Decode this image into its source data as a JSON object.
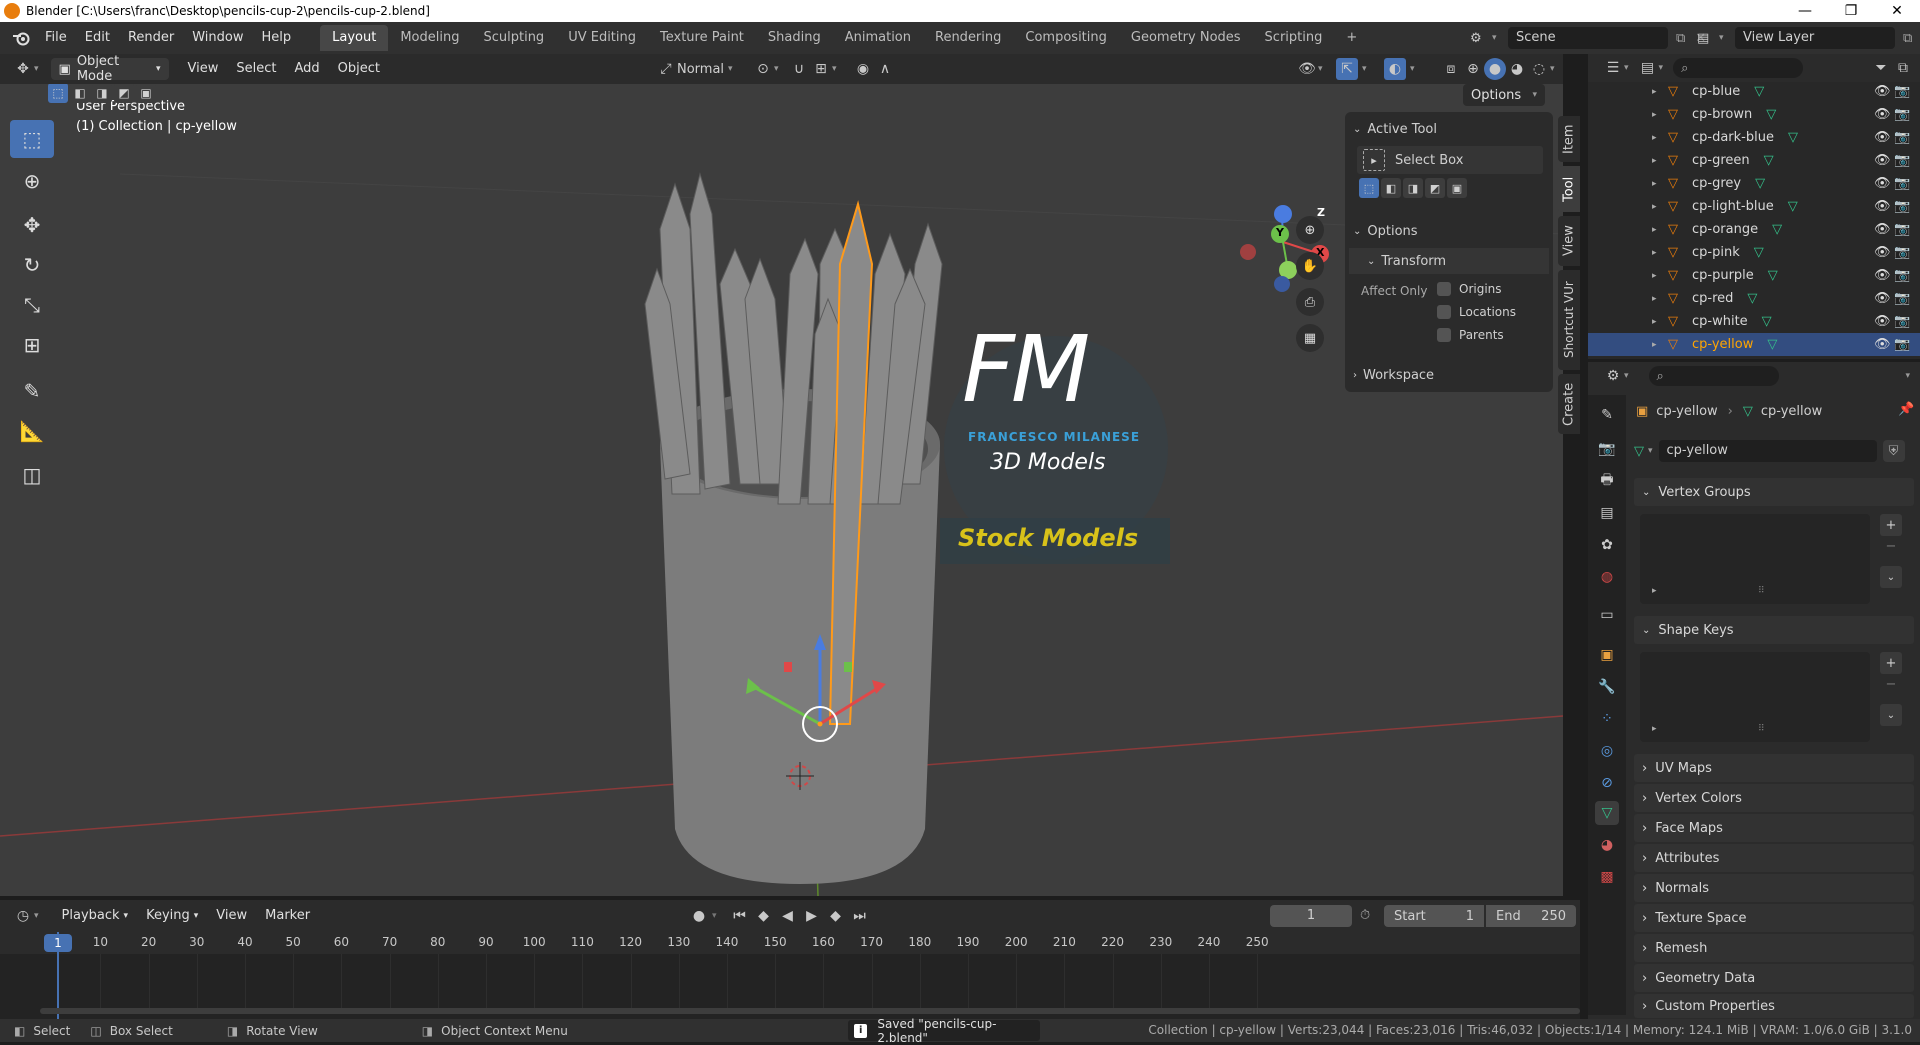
{
  "title": "Blender [C:\\Users\\franc\\Desktop\\pencils-cup-2\\pencils-cup-2.blend]",
  "window_controls": [
    "—",
    "❐",
    "✕"
  ],
  "menu": [
    "File",
    "Edit",
    "Render",
    "Window",
    "Help"
  ],
  "workspaces": [
    "Layout",
    "Modeling",
    "Sculpting",
    "UV Editing",
    "Texture Paint",
    "Shading",
    "Animation",
    "Rendering",
    "Compositing",
    "Geometry Nodes",
    "Scripting"
  ],
  "add_workspace": "+",
  "scene": "Scene",
  "view_layer": "View Layer",
  "viewport_header": {
    "mode": "Object Mode",
    "menus": [
      "View",
      "Select",
      "Add",
      "Object"
    ],
    "orientation": "Normal",
    "options": "Options"
  },
  "viewport": {
    "perspective": "User Perspective",
    "collection": "(1) Collection | cp-yellow",
    "watermark_initials": "FM",
    "watermark_name": "FRANCESCO MILANESE",
    "watermark_sub": "3D Models",
    "watermark_stock": "Stock Models",
    "gizmo_labels": {
      "x": "X",
      "y": "Y",
      "z": "Z"
    }
  },
  "npanel": {
    "active_tool": "Active Tool",
    "tool_name": "Select Box",
    "options": "Options",
    "transform": "Transform",
    "affect_only": "Affect Only",
    "origins": "Origins",
    "locations": "Locations",
    "parents": "Parents",
    "workspace": "Workspace",
    "tabs": [
      "Item",
      "Tool",
      "View",
      "Shortcut VUr",
      "Create"
    ]
  },
  "outliner": {
    "items": [
      {
        "name": "cp-blue"
      },
      {
        "name": "cp-brown"
      },
      {
        "name": "cp-dark-blue"
      },
      {
        "name": "cp-green"
      },
      {
        "name": "cp-grey"
      },
      {
        "name": "cp-light-blue"
      },
      {
        "name": "cp-orange"
      },
      {
        "name": "cp-pink"
      },
      {
        "name": "cp-purple"
      },
      {
        "name": "cp-red"
      },
      {
        "name": "cp-white"
      },
      {
        "name": "cp-yellow",
        "selected": true
      }
    ]
  },
  "properties": {
    "breadcrumb_object": "cp-yellow",
    "breadcrumb_data": "cp-yellow",
    "mesh_name": "cp-yellow",
    "sections": [
      "Vertex Groups",
      "Shape Keys",
      "UV Maps",
      "Vertex Colors",
      "Face Maps",
      "Attributes",
      "Normals",
      "Texture Space",
      "Remesh",
      "Geometry Data",
      "Custom Properties"
    ]
  },
  "timeline": {
    "menus": [
      "Playback",
      "Keying",
      "View",
      "Marker"
    ],
    "current_frame": "1",
    "start_label": "Start",
    "start": "1",
    "end_label": "End",
    "end": "250",
    "ruler": [
      "1",
      "10",
      "20",
      "30",
      "40",
      "50",
      "60",
      "70",
      "80",
      "90",
      "100",
      "110",
      "120",
      "130",
      "140",
      "150",
      "160",
      "170",
      "180",
      "190",
      "200",
      "210",
      "220",
      "230",
      "240",
      "250"
    ]
  },
  "status": {
    "select": "Select",
    "box_select": "Box Select",
    "rotate": "Rotate View",
    "context": "Object Context Menu",
    "saved": "Saved \"pencils-cup-2.blend\"",
    "stats": "Collection | cp-yellow | Verts:23,044 | Faces:23,016 | Tris:46,032 | Objects:1/14 | Memory: 124.1 MiB | VRAM: 1.0/6.0 GiB | 3.1.0"
  },
  "colors": {
    "accent": "#4772b3",
    "selected_object": "#ffa500",
    "mesh_icon": "#e87d0d",
    "data_icon": "#35c08a"
  }
}
